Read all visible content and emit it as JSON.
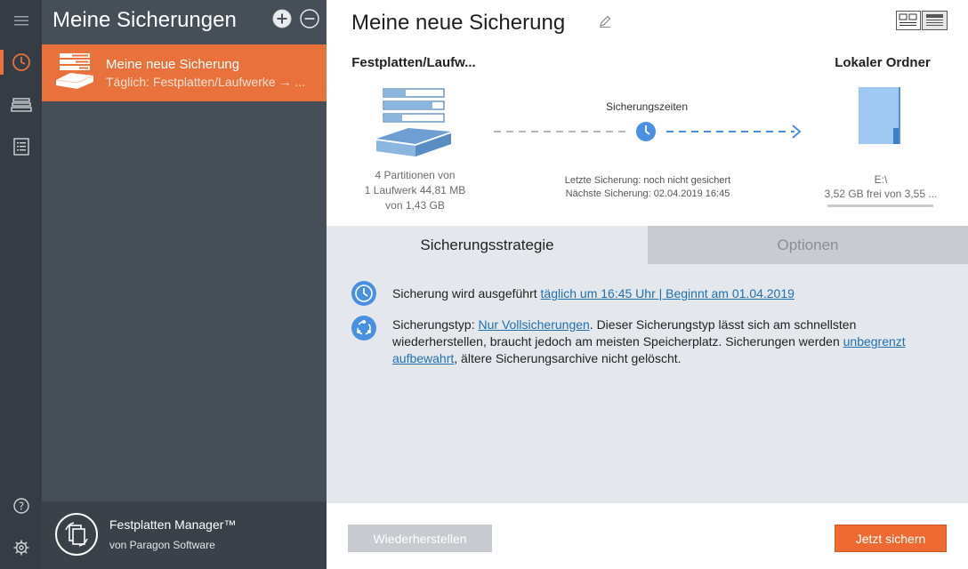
{
  "rail": {
    "icons": [
      "menu-icon",
      "backup-clock-icon",
      "disk-stack-icon",
      "log-list-icon",
      "help-icon",
      "settings-gear-icon"
    ],
    "accent": "#e8713c"
  },
  "panel": {
    "title": "Meine Sicherungen",
    "item": {
      "title": "Meine neue Sicherung",
      "subtitle": "Täglich: Festplatten/Laufwerke → ..."
    },
    "footer": {
      "app_name": "Festplatten Manager™",
      "vendor": "von Paragon Software"
    }
  },
  "main": {
    "title": "Meine neue Sicherung",
    "source": {
      "title": "Festplatten/Laufw...",
      "info_line1": "4 Partitionen von",
      "info_line2": "1 Laufwerk 44,81 MB",
      "info_line3": "von 1,43 GB"
    },
    "schedule": {
      "label": "Sicherungszeiten",
      "last": "Letzte Sicherung: noch nicht gesichert",
      "next": "Nächste Sicherung: 02.04.2019 16:45"
    },
    "destination": {
      "title": "Lokaler Ordner",
      "drive": "E:\\",
      "free": "3,52 GB frei von 3,55 ..."
    },
    "tabs": {
      "strategy": "Sicherungsstrategie",
      "options": "Optionen"
    },
    "strategy": {
      "line1_prefix": "Sicherung wird ausgeführt ",
      "line1_link": "täglich um 16:45 Uhr | Beginnt am 01.04.2019",
      "line2_prefix": "Sicherungstyp: ",
      "line2_link": "Nur Vollsicherungen",
      "line2_rest": ". Dieser Sicherungstyp lässt sich am schnellsten",
      "line3_text": "wiederherstellen, braucht jedoch am meisten Speicherplatz. Sicherungen werden ",
      "line3_link": "unbegrenzt",
      "line4_link": "aufbewahrt",
      "line4_rest": ", ältere Sicherungsarchive nicht gelöscht."
    },
    "buttons": {
      "restore": "Wiederherstellen",
      "backup_now": "Jetzt sichern"
    },
    "colors": {
      "accent_orange": "#ef6a32",
      "link_blue": "#1f6fb3",
      "icon_blue": "#4a90e2"
    }
  }
}
